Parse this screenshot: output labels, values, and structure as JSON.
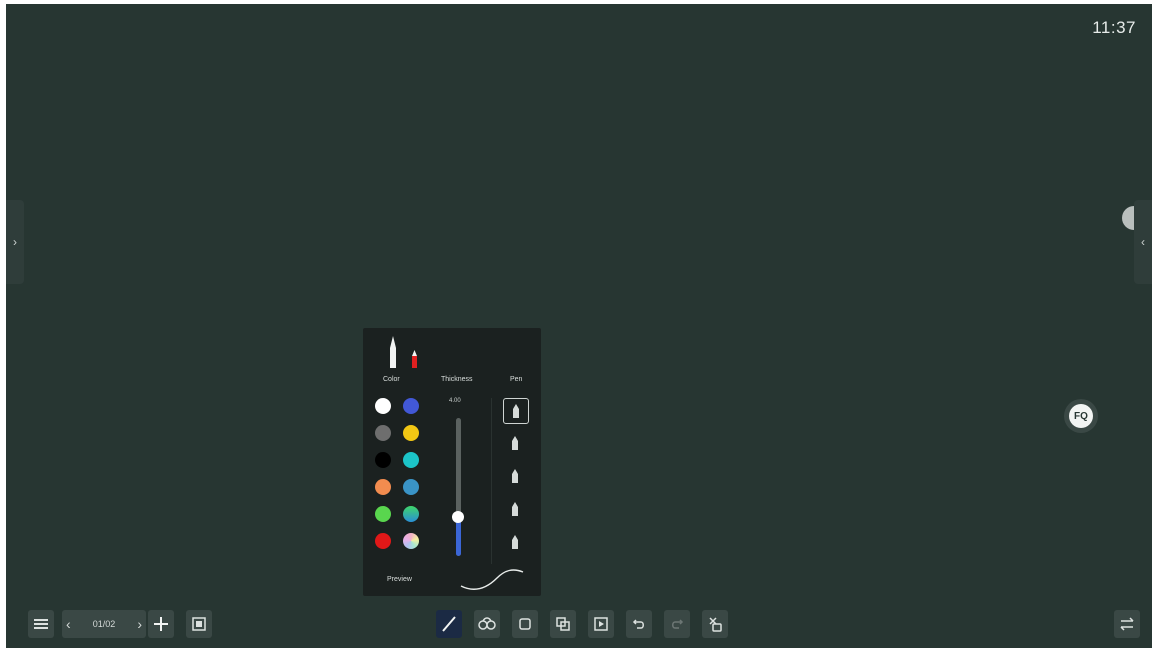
{
  "clock": "11:37",
  "pen_panel": {
    "color_label": "Color",
    "thickness_label": "Thickness",
    "pen_label": "Pen",
    "thickness_value": "4.00",
    "thickness_level_percent": 28,
    "preview_label": "Preview",
    "colors": [
      {
        "name": "white",
        "hex": "#ffffff",
        "selected": true
      },
      {
        "name": "blue",
        "hex": "#4258d6"
      },
      {
        "name": "gray",
        "hex": "#6e6e6e"
      },
      {
        "name": "yellow",
        "hex": "#f2c714"
      },
      {
        "name": "black",
        "hex": "#000000"
      },
      {
        "name": "cyan",
        "hex": "#1cc4c8"
      },
      {
        "name": "orange",
        "hex": "#f28c4f"
      },
      {
        "name": "steel-blue",
        "hex": "#3a94c7"
      },
      {
        "name": "green",
        "hex": "#59d64e"
      },
      {
        "name": "gradient-green-blue",
        "hex": "#2a8fd6"
      },
      {
        "name": "red",
        "hex": "#e01818"
      },
      {
        "name": "rainbow",
        "hex": "#e6d3e0"
      }
    ],
    "pens": [
      "pen-1",
      "pen-2",
      "pen-3",
      "pen-4",
      "pen-5"
    ]
  },
  "pager": {
    "count": "01/02"
  },
  "toolbar_icons": [
    "menu-icon",
    "add-page-icon",
    "page-thumbnails-icon",
    "pen-tool-icon",
    "eraser-icon",
    "select-icon",
    "copy-icon",
    "insert-icon",
    "undo-icon",
    "redo-icon",
    "clear-icon",
    "switch-icon"
  ]
}
